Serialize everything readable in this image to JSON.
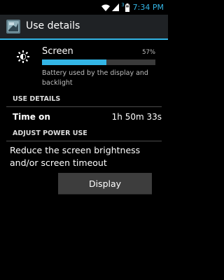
{
  "status_bar": {
    "time": "7:34",
    "am_pm": "PM",
    "sim_indicator": "3",
    "icons": [
      "wifi-icon",
      "signal-icon",
      "battery-icon"
    ],
    "accent_color": "#33b5e5"
  },
  "action_bar": {
    "title": "Use details",
    "icon": "battery-app-icon"
  },
  "usage": {
    "icon": "brightness-icon",
    "label": "Screen",
    "percent_text": "57%",
    "percent_value": 57,
    "description": "Battery used by the display and backlight"
  },
  "sections": {
    "use_details_header": "USE DETAILS",
    "adjust_power_header": "ADJUST POWER USE"
  },
  "details": [
    {
      "label": "Time on",
      "value": "1h 50m 33s"
    }
  ],
  "advice": {
    "text": "Reduce the screen brightness and/or screen timeout",
    "button_label": "Display"
  }
}
